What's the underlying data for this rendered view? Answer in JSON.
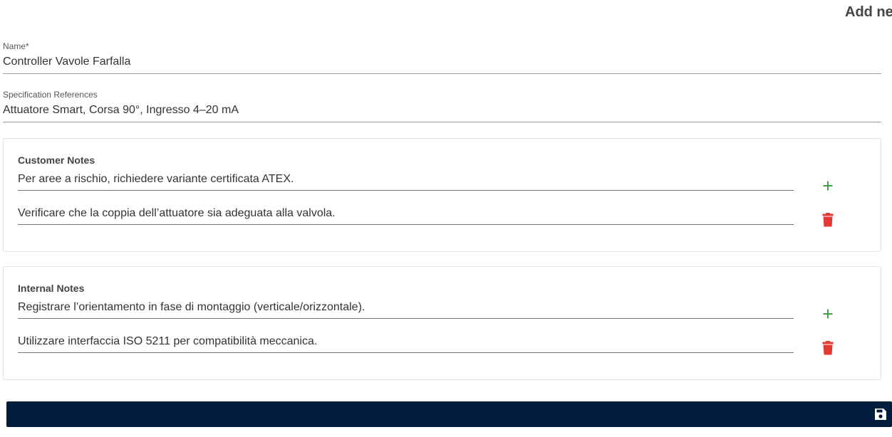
{
  "header": {
    "title": "Add new"
  },
  "form": {
    "name_label": "Name*",
    "name_value": "Controller Vavole Farfalla",
    "spec_label": "Specification References",
    "spec_value": "Attuatore Smart, Corsa 90°, Ingresso 4–20 mA"
  },
  "customer_notes": {
    "title": "Customer Notes",
    "notes": [
      "Per aree a rischio, richiedere variante certificata ATEX.",
      "Verificare che la coppia dell’attuatore sia adeguata alla valvola."
    ]
  },
  "internal_notes": {
    "title": "Internal Notes",
    "notes": [
      "Registrare l’orientamento in fase di montaggio (verticale/orizzontale).",
      "Utilizzare interfaccia ISO 5211 per compatibilità meccanica."
    ]
  },
  "icons": {
    "add": "plus-icon",
    "delete": "trash-icon",
    "save": "floppy-disk-icon"
  },
  "colors": {
    "add_icon": "#43a047",
    "delete_icon": "#e53935",
    "save_bar": "#001d3d",
    "save_icon": "#ffffff"
  }
}
